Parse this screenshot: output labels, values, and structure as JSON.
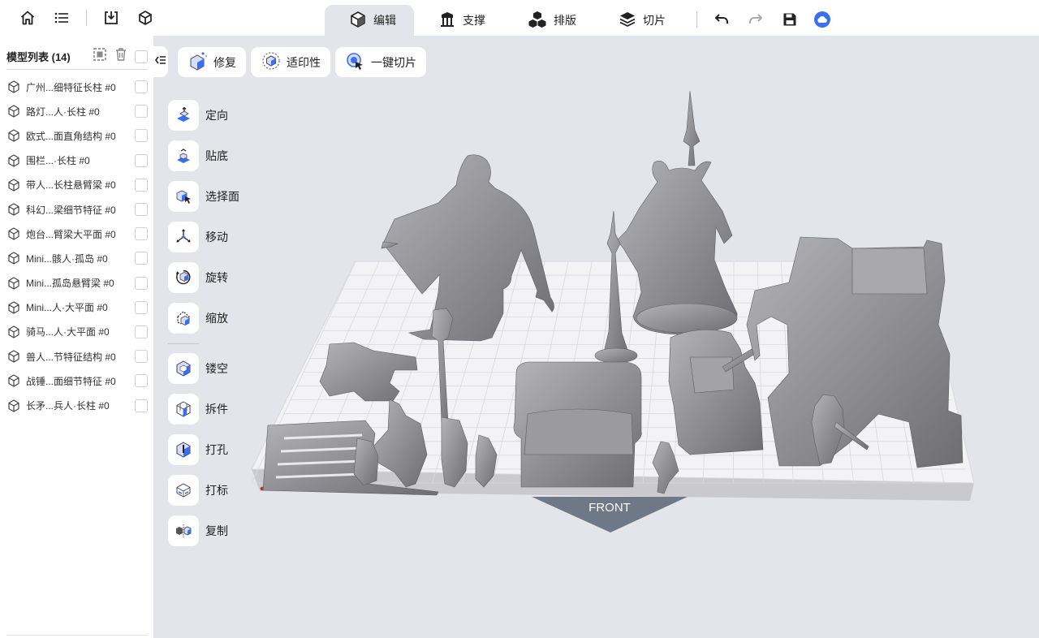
{
  "topbar": {
    "left_icons": [
      "home-icon",
      "list-icon",
      "import-icon",
      "cube-icon"
    ],
    "tabs": [
      {
        "label": "编辑",
        "icon": "cube-icon",
        "active": true
      },
      {
        "label": "支撑",
        "icon": "support-icon",
        "active": false
      },
      {
        "label": "排版",
        "icon": "layout-cubes-icon",
        "active": false
      },
      {
        "label": "切片",
        "icon": "layers-icon",
        "active": false
      }
    ],
    "right_icons": [
      "undo-icon",
      "redo-icon",
      "save-icon",
      "cloud-icon"
    ]
  },
  "sidebar": {
    "title": "模型列表 (14)",
    "models": [
      {
        "name": "广州...细特征长柱 #0"
      },
      {
        "name": "路灯...人·长柱 #0"
      },
      {
        "name": "欧式...面直角结构 #0"
      },
      {
        "name": "围栏...·长柱 #0"
      },
      {
        "name": "带人...长柱悬臂梁 #0"
      },
      {
        "name": "科幻...梁细节特征 #0"
      },
      {
        "name": "炮台...臂梁大平面 #0"
      },
      {
        "name": "Mini...骸人·孤岛 #0"
      },
      {
        "name": "Mini...孤岛悬臂梁 #0"
      },
      {
        "name": "Mini...人·大平面 #0"
      },
      {
        "name": "骑马...人·大平面 #0"
      },
      {
        "name": "兽人...节特征结构 #0"
      },
      {
        "name": "战锤...面细节特征 #0"
      },
      {
        "name": "长矛...兵人·长柱 #0"
      }
    ]
  },
  "actions": [
    {
      "label": "修复",
      "icon": "repair-icon"
    },
    {
      "label": "适印性",
      "icon": "printability-icon"
    },
    {
      "label": "一键切片",
      "icon": "one-click-slice-icon"
    }
  ],
  "tools": [
    {
      "label": "定向",
      "icon": "orient-icon"
    },
    {
      "label": "贴底",
      "icon": "lay-flat-icon"
    },
    {
      "label": "选择面",
      "icon": "select-face-icon"
    },
    {
      "label": "移动",
      "icon": "move-icon"
    },
    {
      "label": "旋转",
      "icon": "rotate-icon"
    },
    {
      "label": "缩放",
      "icon": "scale-icon"
    },
    {
      "label": "镂空",
      "icon": "hollow-icon"
    },
    {
      "label": "拆件",
      "icon": "split-icon"
    },
    {
      "label": "打孔",
      "icon": "drill-icon"
    },
    {
      "label": "打标",
      "icon": "label-icon"
    },
    {
      "label": "复制",
      "icon": "duplicate-icon"
    }
  ],
  "viewport": {
    "front_label": "FRONT",
    "bed_color": "#f4f4f6",
    "model_color": "#8e8e92"
  },
  "colors": {
    "accent": "#3a6ff2",
    "panel": "#ffffff",
    "workspace": "#e4e5ea"
  }
}
